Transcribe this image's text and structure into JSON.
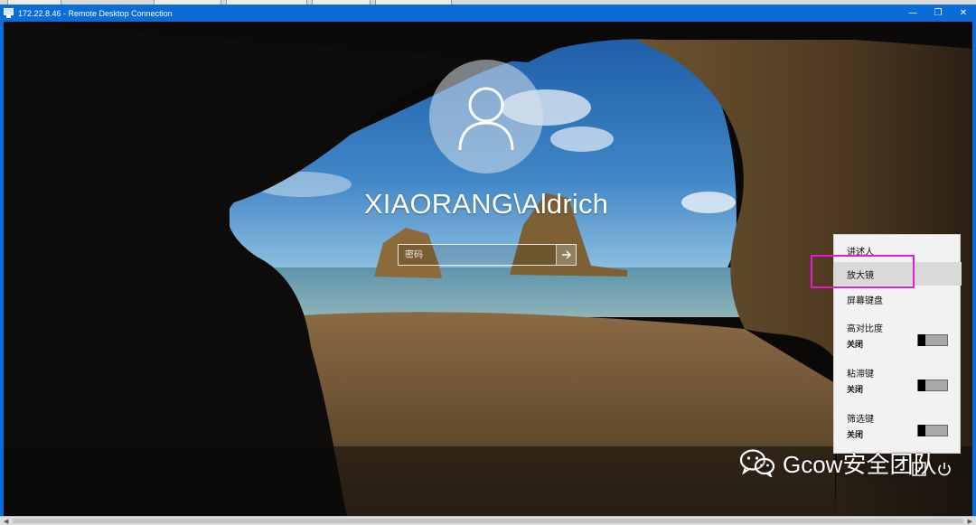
{
  "window": {
    "title": "172.22.8.46 - Remote Desktop Connection",
    "minimize_glyph": "—",
    "maximize_glyph": "❐",
    "close_glyph": "✕",
    "title_bar_color": "#0a6cd6"
  },
  "login": {
    "username": "XIAORANG\\Aldrich",
    "password_placeholder": "密码",
    "submit_icon": "arrow-right-icon",
    "avatar_icon": "user-icon"
  },
  "accessibility_menu": {
    "items": [
      {
        "label": "讲述人"
      },
      {
        "label": "放大镜"
      },
      {
        "label": "屏幕键盘"
      }
    ],
    "toggles": [
      {
        "label": "高对比度",
        "state": "关闭"
      },
      {
        "label": "粘滞键",
        "state": "关闭"
      },
      {
        "label": "筛选键",
        "state": "关闭"
      }
    ],
    "highlight_color": "#e619d6"
  },
  "watermark": {
    "text": "Gcow安全团队",
    "logo_icon": "wechat-icon"
  },
  "system_icons": [
    "ease-of-access-icon",
    "power-icon"
  ]
}
